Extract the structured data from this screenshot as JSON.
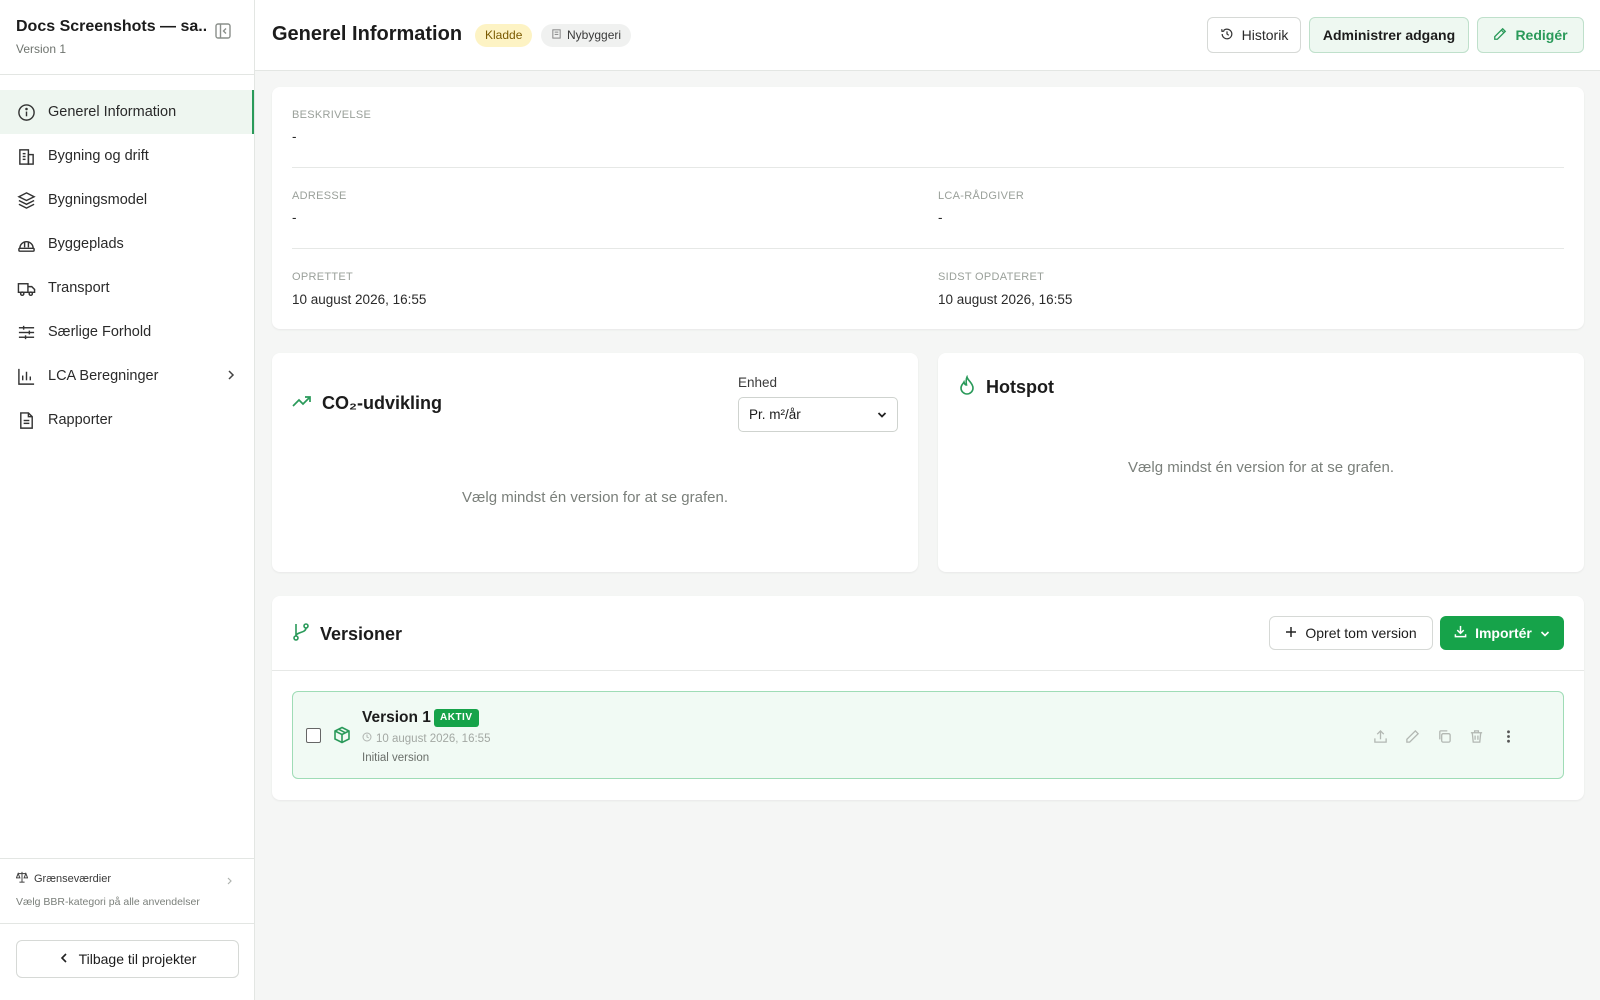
{
  "sidebar": {
    "project_title": "Docs Screenshots — sa...",
    "version": "Version 1",
    "items": [
      {
        "label": "Generel Information",
        "icon": "info-icon"
      },
      {
        "label": "Bygning og drift",
        "icon": "building-icon"
      },
      {
        "label": "Bygningsmodel",
        "icon": "layers-icon"
      },
      {
        "label": "Byggeplads",
        "icon": "hardhat-icon"
      },
      {
        "label": "Transport",
        "icon": "truck-icon"
      },
      {
        "label": "Særlige Forhold",
        "icon": "sliders-icon"
      },
      {
        "label": "LCA Beregninger",
        "icon": "bar-chart-icon"
      },
      {
        "label": "Rapporter",
        "icon": "document-icon"
      }
    ],
    "limits_title": "Grænseværdier",
    "limits_sub": "Vælg BBR-kategori på alle anvendelser",
    "back_label": "Tilbage til projekter"
  },
  "header": {
    "title": "Generel Information",
    "status_badge": "Kladde",
    "type_badge": "Nybyggeri",
    "history_label": "Historik",
    "access_label": "Administrer adgang",
    "edit_label": "Redigér"
  },
  "info": {
    "description_label": "BESKRIVELSE",
    "description_value": "-",
    "address_label": "ADRESSE",
    "address_value": "-",
    "advisor_label": "LCA-RÅDGIVER",
    "advisor_value": "-",
    "created_label": "OPRETTET",
    "created_value": "10 august 2026, 16:55",
    "updated_label": "SIDST OPDATERET",
    "updated_value": "10 august 2026, 16:55"
  },
  "co2": {
    "title": "CO₂-udvikling",
    "unit_label": "Enhed",
    "unit_value": "Pr. m²/år",
    "empty": "Vælg mindst én version for at se grafen."
  },
  "hotspot": {
    "title": "Hotspot",
    "empty": "Vælg mindst én version for at se grafen."
  },
  "versions": {
    "title": "Versioner",
    "create_label": "Opret tom version",
    "import_label": "Importér",
    "rows": [
      {
        "name": "Version 1",
        "badge": "AKTIV",
        "time": "10 august 2026, 16:55",
        "description": "Initial version"
      }
    ]
  },
  "colors": {
    "accent": "#16a34a",
    "accent_soft": "#eef8f1",
    "kladde_bg": "#fdf3c4"
  }
}
